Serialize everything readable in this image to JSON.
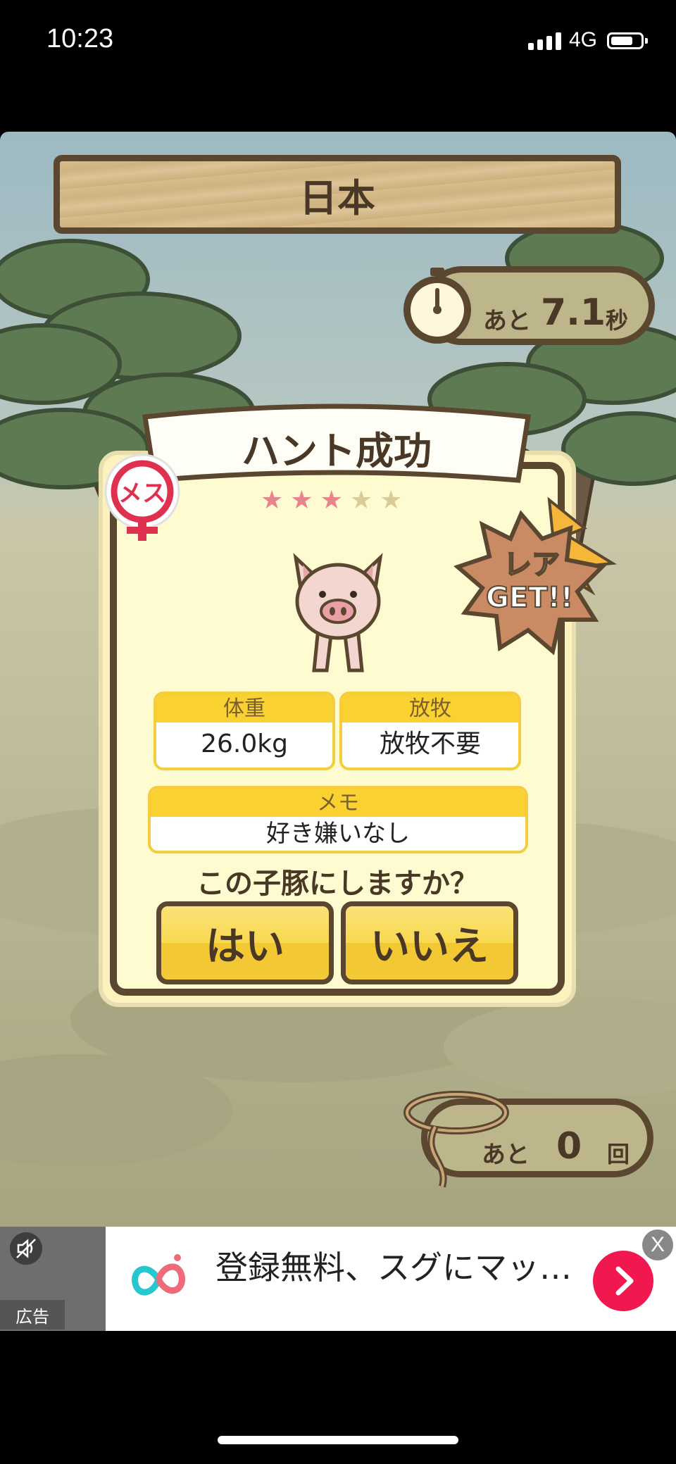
{
  "status_bar": {
    "time": "10:23",
    "network": "4G"
  },
  "header": {
    "location": "日本"
  },
  "timer": {
    "prefix": "あと",
    "value": "7.1",
    "unit": "秒"
  },
  "result": {
    "title": "ハント成功",
    "gender_label": "メス",
    "rarity": {
      "filled": 3,
      "total": 5
    },
    "rare_badge": "レア\nGET!!",
    "fields": {
      "weight": {
        "label": "体重",
        "value": "26.0kg"
      },
      "grazing": {
        "label": "放牧",
        "value": "放牧不要"
      },
      "memo": {
        "label": "メモ",
        "value": "好き嫌いなし"
      }
    },
    "question": "この子豚にしますか？",
    "yes_label": "はい",
    "no_label": "いいえ"
  },
  "shots": {
    "prefix": "あと",
    "value": "0",
    "unit": "回"
  },
  "ad": {
    "tag": "広告",
    "text": "登録無料、スグにマッ…",
    "close": "X"
  },
  "colors": {
    "wood_dark": "#5b4630",
    "button_yellow": "#f8d94f",
    "star_on": "#e8848f",
    "ad_cta": "#f0184f"
  }
}
